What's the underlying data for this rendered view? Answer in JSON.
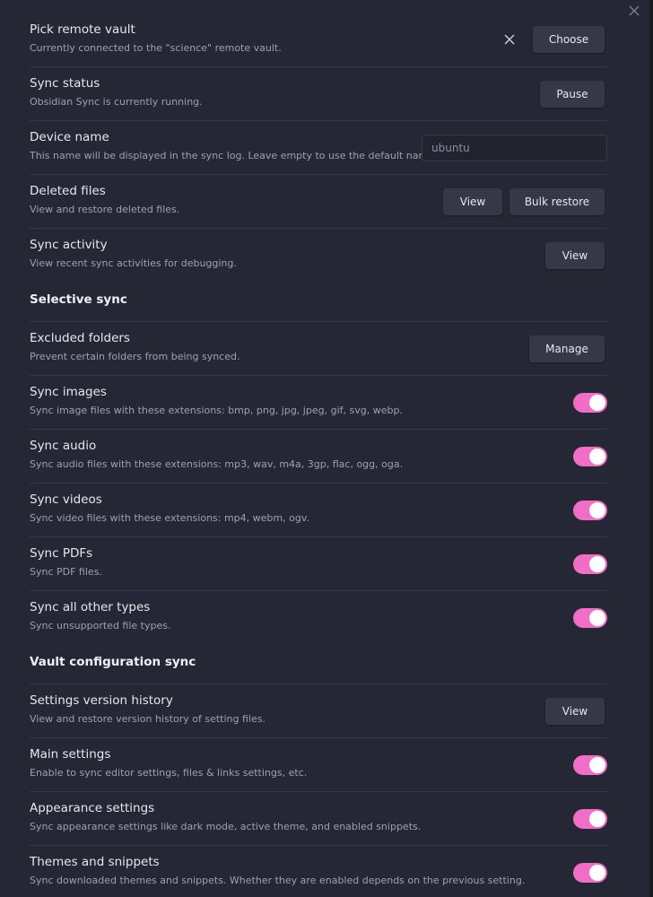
{
  "colors": {
    "accent": "#f06ec8",
    "background": "#262734",
    "button": "#363848"
  },
  "remote_vault": {
    "name": "Pick remote vault",
    "desc": "Currently connected to the \"science\" remote vault.",
    "choose_label": "Choose"
  },
  "sync_status": {
    "name": "Sync status",
    "desc": "Obsidian Sync is currently running.",
    "pause_label": "Pause"
  },
  "device_name": {
    "name": "Device name",
    "desc": "This name will be displayed in the sync log. Leave empty to use the default name.",
    "placeholder": "ubuntu",
    "value": ""
  },
  "deleted_files": {
    "name": "Deleted files",
    "desc": "View and restore deleted files.",
    "view_label": "View",
    "bulk_restore_label": "Bulk restore"
  },
  "sync_activity": {
    "name": "Sync activity",
    "desc": "View recent sync activities for debugging.",
    "view_label": "View"
  },
  "selective_sync": {
    "heading": "Selective sync",
    "excluded_folders": {
      "name": "Excluded folders",
      "desc": "Prevent certain folders from being synced.",
      "manage_label": "Manage"
    },
    "toggles": [
      {
        "name": "Sync images",
        "desc": "Sync image files with these extensions: bmp, png, jpg, jpeg, gif, svg, webp.",
        "enabled": true
      },
      {
        "name": "Sync audio",
        "desc": "Sync audio files with these extensions: mp3, wav, m4a, 3gp, flac, ogg, oga.",
        "enabled": true
      },
      {
        "name": "Sync videos",
        "desc": "Sync video files with these extensions: mp4, webm, ogv.",
        "enabled": true
      },
      {
        "name": "Sync PDFs",
        "desc": "Sync PDF files.",
        "enabled": true
      },
      {
        "name": "Sync all other types",
        "desc": "Sync unsupported file types.",
        "enabled": true
      }
    ]
  },
  "vault_config_sync": {
    "heading": "Vault configuration sync",
    "settings_history": {
      "name": "Settings version history",
      "desc": "View and restore version history of setting files.",
      "view_label": "View"
    },
    "toggles": [
      {
        "name": "Main settings",
        "desc": "Enable to sync editor settings, files & links settings, etc.",
        "enabled": true
      },
      {
        "name": "Appearance settings",
        "desc": "Sync appearance settings like dark mode, active theme, and enabled snippets.",
        "enabled": true
      },
      {
        "name": "Themes and snippets",
        "desc": "Sync downloaded themes and snippets. Whether they are enabled depends on the previous setting.",
        "enabled": true
      }
    ]
  }
}
